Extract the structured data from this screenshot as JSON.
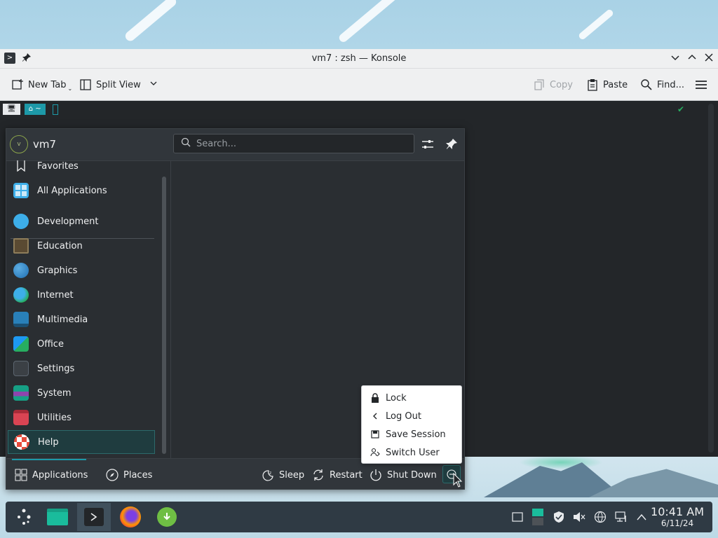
{
  "window": {
    "title": "vm7 : zsh — Konsole",
    "toolbar": {
      "new_tab": "New Tab",
      "split_view": "Split View",
      "copy": "Copy",
      "paste": "Paste",
      "find": "Find..."
    },
    "prompt": {
      "seg1": "🖥",
      "seg2": "⌂ ~"
    }
  },
  "launcher": {
    "username": "vm7",
    "avatar_initial": "v",
    "search": {
      "placeholder": "Search..."
    },
    "categories": [
      {
        "label": "Favorites",
        "color": "#bdc3c7"
      },
      {
        "label": "All Applications",
        "color": "#3daee9"
      },
      {
        "label": "Development",
        "color": "#3daee9"
      },
      {
        "label": "Education",
        "color": "#8e7d5a"
      },
      {
        "label": "Graphics",
        "color": "#2e86de"
      },
      {
        "label": "Internet",
        "color": "#27ae60"
      },
      {
        "label": "Multimedia",
        "color": "#2980b9"
      },
      {
        "label": "Office",
        "color": "#1d99f3"
      },
      {
        "label": "Settings",
        "color": "#5c6670"
      },
      {
        "label": "System",
        "color": "#16a085"
      },
      {
        "label": "Utilities",
        "color": "#da4453"
      },
      {
        "label": "Help",
        "color": "#e74c3c"
      }
    ],
    "active_category": "Help",
    "footer": {
      "applications": "Applications",
      "places": "Places",
      "sleep": "Sleep",
      "restart": "Restart",
      "shut_down": "Shut Down"
    }
  },
  "power_menu": {
    "items": [
      "Lock",
      "Log Out",
      "Save Session",
      "Switch User"
    ]
  },
  "taskbar": {
    "clock": {
      "time": "10:41 AM",
      "date": "6/11/24"
    }
  },
  "colors": {
    "accent": "#1d99a8",
    "panel": "#2f3a44",
    "menu_bg": "#2a2e32"
  }
}
